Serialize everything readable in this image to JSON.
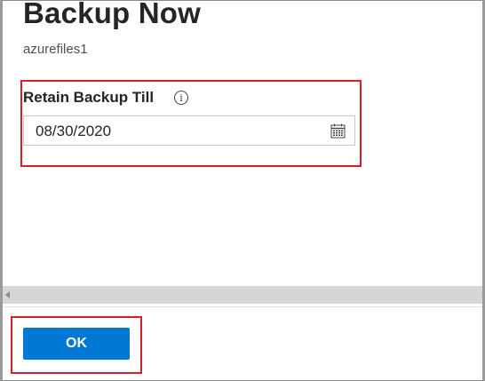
{
  "header": {
    "title": "Backup Now",
    "subtitle": "azurefiles1"
  },
  "form": {
    "retain_label": "Retain Backup Till",
    "info_icon": "info-icon",
    "date_value": "08/30/2020",
    "calendar_icon": "calendar-icon"
  },
  "footer": {
    "ok_label": "OK"
  },
  "colors": {
    "accent": "#0078d4",
    "highlight_border": "#d9202a"
  }
}
